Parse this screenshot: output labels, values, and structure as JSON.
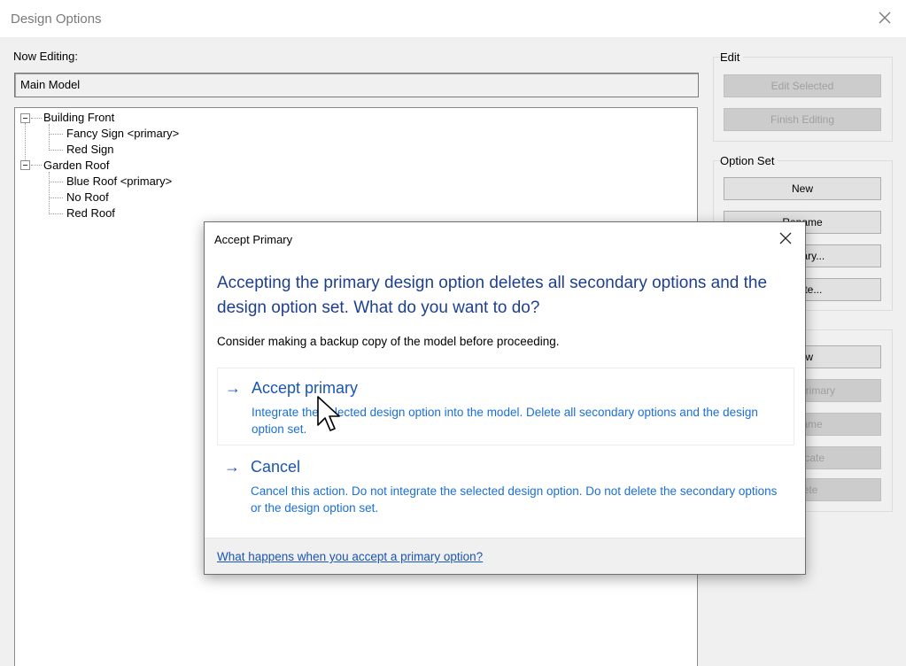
{
  "window": {
    "title": "Design Options"
  },
  "now_editing": {
    "label": "Now Editing:",
    "value": "Main Model"
  },
  "tree": {
    "groups": [
      {
        "label": "Building Front",
        "children": [
          "Fancy Sign <primary>",
          "Red Sign"
        ]
      },
      {
        "label": "Garden Roof",
        "children": [
          "Blue Roof <primary>",
          "No Roof",
          "Red Roof"
        ]
      }
    ]
  },
  "edit_group": {
    "label": "Edit",
    "edit_selected": "Edit Selected",
    "finish_editing": "Finish Editing"
  },
  "option_set_group": {
    "label": "Option Set",
    "new": "New",
    "rename": "Rename",
    "primary": "Primary...",
    "delete": "Delete..."
  },
  "option_group": {
    "new": "New",
    "make_primary": "Make Primary",
    "rename": "Rename",
    "duplicate": "Duplicate",
    "delete": "Delete"
  },
  "dialog": {
    "title": "Accept Primary",
    "heading": "Accepting the primary design option deletes all secondary options and the design option set. What do you want to do?",
    "body": "Consider making a backup copy of the model before proceeding.",
    "commands": [
      {
        "arrow": "→",
        "title": "Accept primary",
        "description": "Integrate the selected design option into the model. Delete all secondary options and the design option set."
      },
      {
        "arrow": "→",
        "title": "Cancel",
        "description": "Cancel this action. Do not integrate the selected design option. Do not delete the secondary options or the design option set."
      }
    ],
    "footer_link": "What happens when you accept a primary option?"
  }
}
